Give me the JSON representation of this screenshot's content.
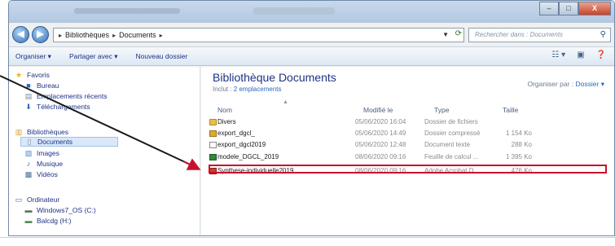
{
  "window": {
    "controls": {
      "minimize": "–",
      "maximize": "□",
      "close": "X"
    }
  },
  "address": {
    "back_icon": "back-arrow-icon",
    "forward_icon": "forward-arrow-icon",
    "crumbs": [
      "Bibliothèques",
      "Documents"
    ],
    "separator": "▸",
    "search_placeholder": "Rechercher dans : Documents"
  },
  "toolbar": {
    "organize": "Organiser ▾",
    "share": "Partager avec ▾",
    "new_folder": "Nouveau dossier"
  },
  "sidebar": {
    "favorites_label": "Favoris",
    "favorites": [
      "Bureau",
      "Emplacements récents",
      "Téléchargements"
    ],
    "libraries_label": "Bibliothèques",
    "libraries": [
      "Documents",
      "Images",
      "Musique",
      "Vidéos"
    ],
    "computer_label": "Ordinateur",
    "drives": [
      "Windows7_OS (C:)",
      "Balcdg (H:)"
    ]
  },
  "library": {
    "title": "Bibliothèque Documents",
    "includes_prefix": "Inclut : ",
    "includes_link": "2 emplacements",
    "arrange_label": "Organiser par : ",
    "arrange_value": "Dossier ▾"
  },
  "columns": {
    "name": "Nom",
    "modified": "Modifié le",
    "type": "Type",
    "size": "Taille"
  },
  "files": [
    {
      "name": "Divers",
      "modified": "05/06/2020 16:04",
      "type": "Dossier de fichiers",
      "size": "",
      "icon": "folder-icon"
    },
    {
      "name": "export_dgcl_",
      "modified": "05/06/2020 14:49",
      "type": "Dossier compressé",
      "size": "1 154 Ko",
      "icon": "zip-folder-icon"
    },
    {
      "name": "export_dgcl2019",
      "modified": "05/06/2020 12:48",
      "type": "Document texte",
      "size": "288 Ko",
      "icon": "text-file-icon"
    },
    {
      "name": "modele_DGCL_2019",
      "modified": "08/06/2020 09:16",
      "type": "Feuille de calcul ...",
      "size": "1 395 Ko",
      "icon": "spreadsheet-icon"
    },
    {
      "name": "Synthese-individuelle2019",
      "modified": "08/06/2020 09:16",
      "type": "Adobe Acrobat D...",
      "size": "476 Ko",
      "icon": "pdf-icon"
    }
  ],
  "colors": {
    "highlight": "#c8102e",
    "link": "#2a68c2",
    "title": "#1e3287"
  }
}
